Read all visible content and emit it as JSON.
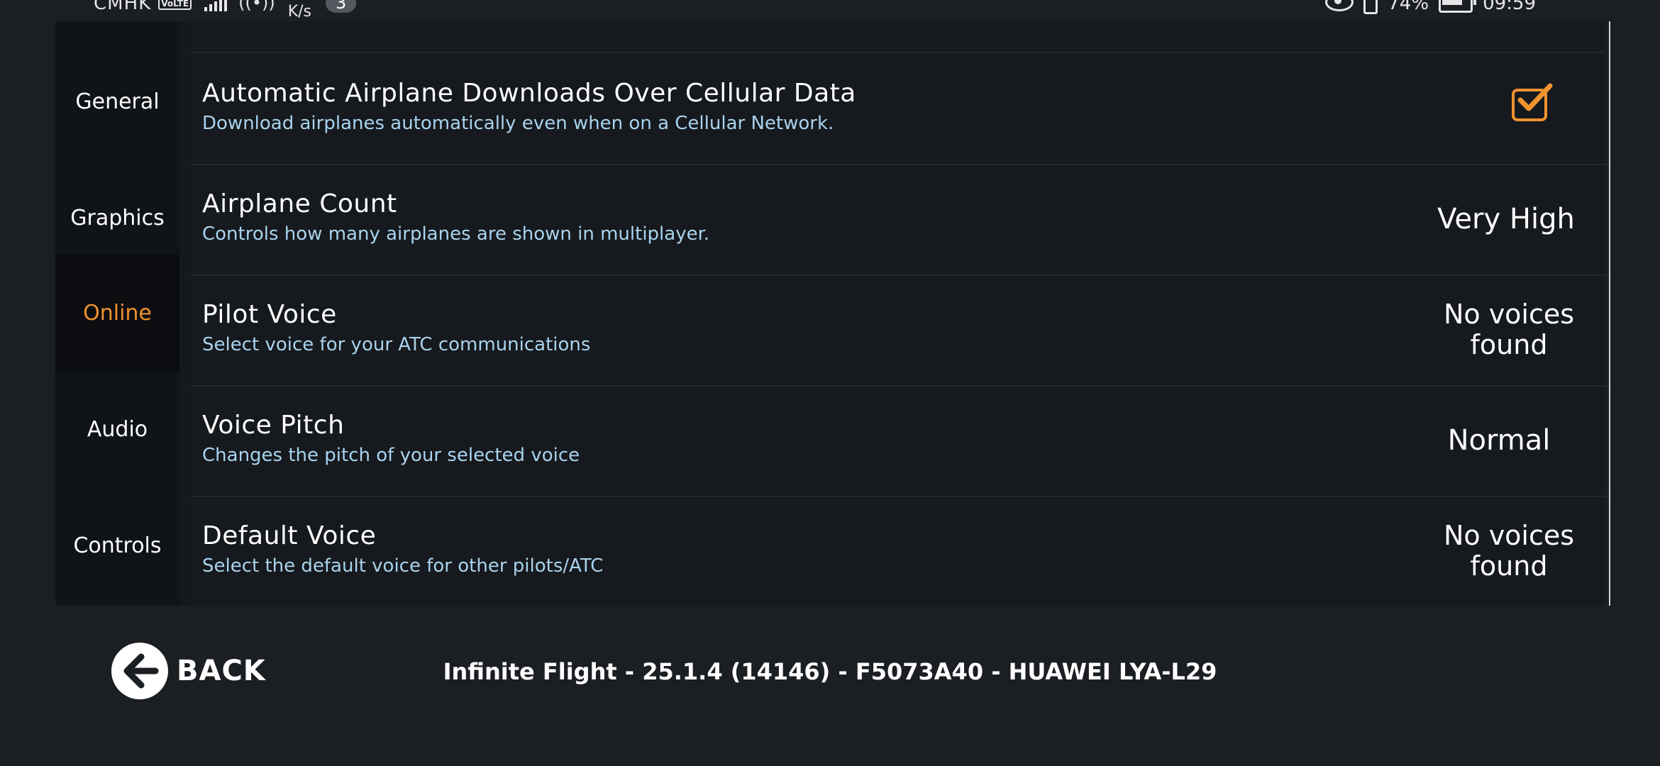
{
  "status_bar": {
    "carrier": "CMHK",
    "volte": "VoLTE",
    "speed_unit": "K/s",
    "notification_count": "3",
    "battery": "74%",
    "time": "09:59"
  },
  "sidebar": {
    "items": [
      {
        "label": "General"
      },
      {
        "label": "Graphics"
      },
      {
        "label": "Online"
      },
      {
        "label": "Audio"
      },
      {
        "label": "Controls"
      }
    ],
    "active": "Online",
    "accent_color": "#f0922e"
  },
  "settings": [
    {
      "title": "Automatic Airplane Downloads Over Cellular Data",
      "description": "Download airplanes automatically even when on a Cellular Network.",
      "control": "checkbox",
      "checked": true
    },
    {
      "title": "Airplane Count",
      "description": "Controls how many airplanes are shown in multiplayer.",
      "value": "Very High"
    },
    {
      "title": "Pilot Voice",
      "description": "Select voice for your ATC communications",
      "value": "No voices found"
    },
    {
      "title": "Voice Pitch",
      "description": "Changes the pitch of your selected voice",
      "value": "Normal"
    },
    {
      "title": "Default Voice",
      "description": "Select the default voice for other pilots/ATC",
      "value": "No voices found"
    }
  ],
  "footer": {
    "back_label": "BACK",
    "back_icon": "arrow-left-circle-icon",
    "version_text": "Infinite Flight - 25.1.4 (14146) - F5073A40 - HUAWEI LYA-L29"
  }
}
